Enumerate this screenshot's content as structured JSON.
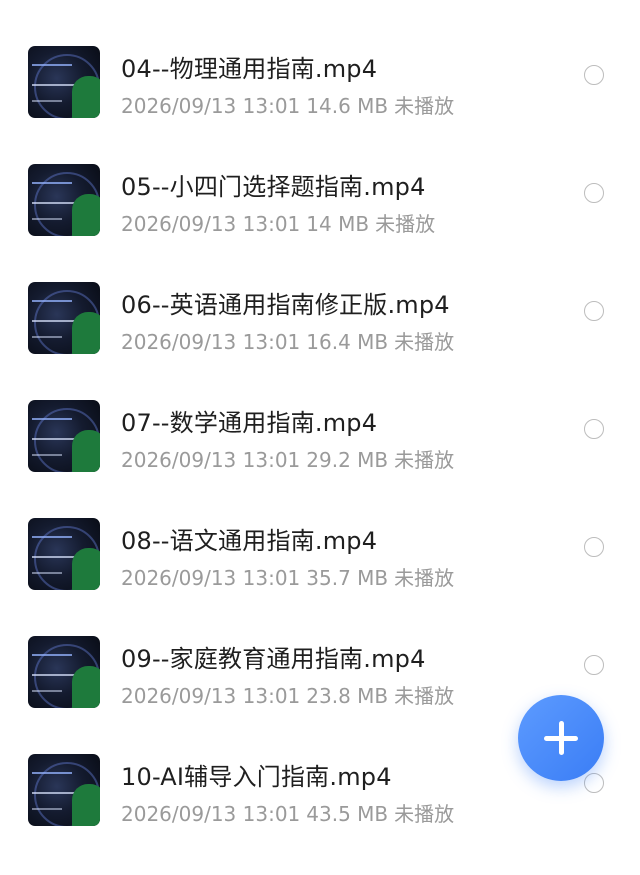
{
  "files": [
    {
      "title": "04--物理通用指南.mp4",
      "date": "2026/09/13 13:01",
      "size": "14.6 MB",
      "status": "未播放",
      "thumb_icon": "video-thumbnail"
    },
    {
      "title": "05--小四门选择题指南.mp4",
      "date": "2026/09/13 13:01",
      "size": "14 MB",
      "status": "未播放",
      "thumb_icon": "video-thumbnail"
    },
    {
      "title": "06--英语通用指南修正版.mp4",
      "date": "2026/09/13 13:01",
      "size": "16.4 MB",
      "status": "未播放",
      "thumb_icon": "video-thumbnail"
    },
    {
      "title": "07--数学通用指南.mp4",
      "date": "2026/09/13 13:01",
      "size": "29.2 MB",
      "status": "未播放",
      "thumb_icon": "video-thumbnail"
    },
    {
      "title": "08--语文通用指南.mp4",
      "date": "2026/09/13 13:01",
      "size": "35.7 MB",
      "status": "未播放",
      "thumb_icon": "video-thumbnail"
    },
    {
      "title": "09--家庭教育通用指南.mp4",
      "date": "2026/09/13 13:01",
      "size": "23.8 MB",
      "status": "未播放",
      "thumb_icon": "video-thumbnail"
    },
    {
      "title": "10-AI辅导入门指南.mp4",
      "date": "2026/09/13 13:01",
      "size": "43.5 MB",
      "status": "未播放",
      "thumb_icon": "video-thumbnail"
    }
  ],
  "fab": {
    "icon": "plus-icon",
    "color": "#3a7df5"
  },
  "colors": {
    "title": "#1f1f1f",
    "meta": "#9a9a9a",
    "radio_border": "#bdbdbd"
  }
}
